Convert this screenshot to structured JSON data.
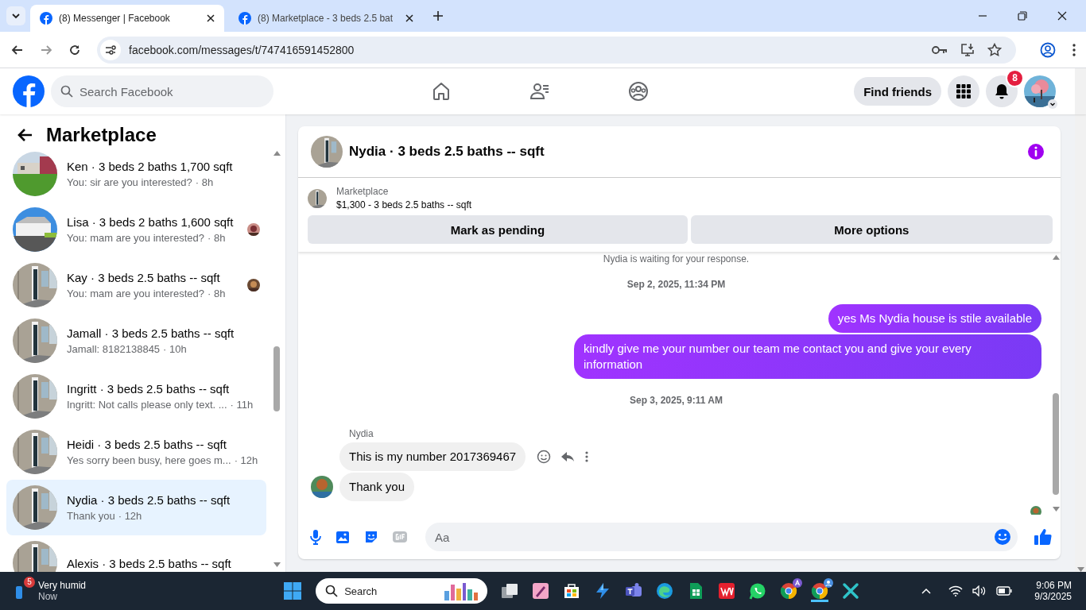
{
  "browser": {
    "tabs": [
      {
        "title": "(8) Messenger | Facebook",
        "selected": true
      },
      {
        "title": "(8) Marketplace - 3 beds 2.5 bat",
        "selected": false
      }
    ],
    "url": "facebook.com/messages/t/747416591452800"
  },
  "header": {
    "search": {
      "placeholder": "Search Facebook"
    },
    "find_friends": "Find friends",
    "notification_count": "8"
  },
  "sidebar": {
    "title": "Marketplace",
    "conversations": [
      {
        "title": "Ken · 3 beds 2 baths 1,700 sqft",
        "preview": "You: sir are you interested?",
        "time": "· 8h",
        "selected": false,
        "seen": false
      },
      {
        "title": "Lisa · 3 beds 2 baths 1,600 sqft",
        "preview": "You: mam are you interested?",
        "time": "· 8h",
        "selected": false,
        "seen": true
      },
      {
        "title": "Kay · 3 beds 2.5 baths -- sqft",
        "preview": "You: mam are you interested?",
        "time": "· 8h",
        "selected": false,
        "seen": true
      },
      {
        "title": "Jamall · 3 beds 2.5 baths -- sqft",
        "preview": "Jamall: 8182138845",
        "time": "· 10h",
        "selected": false,
        "seen": false
      },
      {
        "title": "Ingritt · 3 beds 2.5 baths -- sqft",
        "preview": "Ingritt: Not calls please only text. ...",
        "time": "· 11h",
        "selected": false,
        "seen": false
      },
      {
        "title": "Heidi · 3 beds 2.5 baths -- sqft",
        "preview": "Yes sorry been busy, here goes m...",
        "time": "· 12h",
        "selected": false,
        "seen": false
      },
      {
        "title": "Nydia · 3 beds 2.5 baths -- sqft",
        "preview": "Thank you",
        "time": "· 12h",
        "selected": true,
        "seen": false
      },
      {
        "title": "Alexis · 3 beds 2.5 baths -- sqft",
        "selected": false,
        "seen": false
      }
    ]
  },
  "chat": {
    "title": "Nydia · 3 beds 2.5 baths -- sqft",
    "listing": {
      "label": "Marketplace",
      "summary": "$1,300 - 3 beds 2.5 baths -- sqft"
    },
    "actions": [
      "Mark as pending",
      "More options"
    ],
    "notice": "Nydia is waiting for your response.",
    "messages": [
      {
        "kind": "timestamp",
        "text": "Sep 2, 2025, 11:34 PM"
      },
      {
        "kind": "outgoing",
        "text": "yes Ms Nydia house is stile available"
      },
      {
        "kind": "outgoing",
        "text": "kindly give me your number our team me contact you and give your every information"
      },
      {
        "kind": "timestamp",
        "text": "Sep 3, 2025, 9:11 AM"
      },
      {
        "kind": "sender",
        "text": "Nydia"
      },
      {
        "kind": "incoming",
        "text": "This is my number 2017369467",
        "hovered": true,
        "avatar": false
      },
      {
        "kind": "incoming",
        "text": "Thank you",
        "hovered": false,
        "avatar": true
      }
    ],
    "composer": {
      "placeholder": "Aa"
    }
  },
  "taskbar": {
    "weather_badge": "5",
    "weather": "Very humid",
    "weather_time": "Now",
    "search": {
      "placeholder": "Search"
    },
    "time": "9:06 PM",
    "date": "9/3/2025"
  }
}
